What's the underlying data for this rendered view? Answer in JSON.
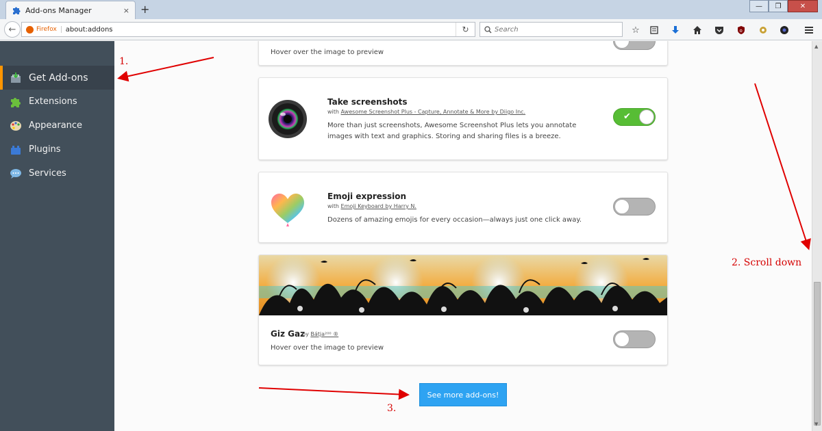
{
  "window": {
    "tab_title": "Add-ons Manager",
    "tab_close": "×",
    "new_tab": "+",
    "minimize": "—",
    "restore": "❐",
    "close": "✕"
  },
  "navbar": {
    "identity_label": "Firefox",
    "url": "about:addons",
    "search_placeholder": "Search"
  },
  "sidebar": {
    "items": [
      {
        "label": "Get Add-ons",
        "icon": "get-addons-icon",
        "active": true
      },
      {
        "label": "Extensions",
        "icon": "puzzle-icon"
      },
      {
        "label": "Appearance",
        "icon": "palette-icon"
      },
      {
        "label": "Plugins",
        "icon": "plugin-brick-icon"
      },
      {
        "label": "Services",
        "icon": "speech-bubble-icon"
      }
    ]
  },
  "cards": {
    "top_partial": {
      "description": "Hover over the image to preview",
      "enabled": false
    },
    "screenshots": {
      "title": "Take screenshots",
      "author_prefix": "with",
      "author": "Awesome Screenshot Plus - Capture, Annotate & More by Diigo Inc.",
      "description": "More than just screenshots, Awesome Screenshot Plus lets you annotate images with text and graphics. Storing and sharing files is a breeze.",
      "enabled": true,
      "check": "✔"
    },
    "emoji": {
      "title": "Emoji expression",
      "author_prefix": "with",
      "author": "Emoji Keyboard by Harry N.",
      "description": "Dozens of amazing emojis for every occasion—always just one click away.",
      "enabled": false
    },
    "theme": {
      "title": "Giz Gaz",
      "author_prefix": "by",
      "author": "Bátja²⁰⁰ ®",
      "description": "Hover over the image to preview",
      "enabled": false
    }
  },
  "see_more_label": "See more add-ons!",
  "annotations": {
    "step1": "1.",
    "step2": "2. Scroll down",
    "step3": "3."
  },
  "colors": {
    "sidebar_bg": "#424f5a",
    "active_accent": "#ff9500",
    "toggle_on": "#57bd35",
    "button_blue": "#2ea3f2",
    "annotation_red": "#d50000"
  }
}
